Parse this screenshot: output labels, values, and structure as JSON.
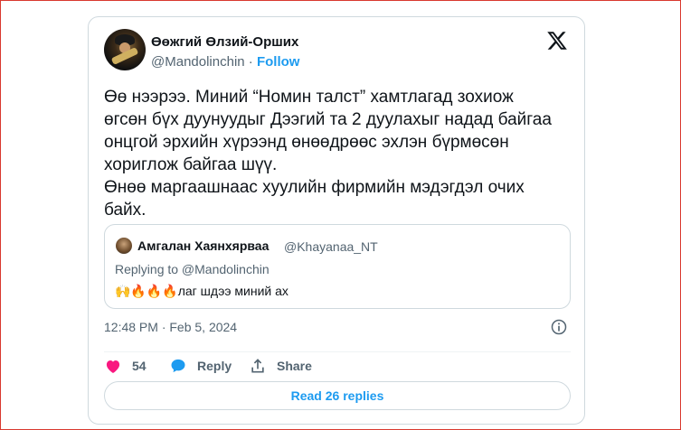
{
  "author": {
    "name": "Өөжгий Өлзий-Орших",
    "handle": "@Mandolinchin",
    "separator": "·",
    "follow_label": "Follow"
  },
  "tweet": {
    "text": "Өө нээрээ. Миний  “Номин талст” хамтлагад зохиож\nөгсөн бүх дуунуудыг  Дээгий та 2 дуулахыг надад байгаа\nонцгой эрхийн хүрээнд өнөөдрөөс эхлэн бүрмөсөн\nхориглож байгаа шүү.\nӨнөө маргаашнаас хуулийн фирмийн мэдэгдэл очих\nбайх."
  },
  "quote": {
    "name": "Амгалан Хаянхярваа",
    "handle": "@Khayanaa_NT",
    "replying_to": "Replying to @Mandolinchin",
    "text": "🙌🔥🔥🔥лаг шдээ миний ах"
  },
  "timestamp": "12:48 PM · Feb 5, 2024",
  "actions": {
    "like_count": "54",
    "reply_label": "Reply",
    "share_label": "Share"
  },
  "read_replies_label": "Read 26 replies",
  "icons": [
    "x-logo-icon",
    "info-icon",
    "heart-icon",
    "reply-bubble-icon",
    "share-icon"
  ],
  "colors": {
    "accent": "#1d9bf0",
    "like": "#f91880",
    "muted": "#536471",
    "border": "#cfd9de"
  }
}
